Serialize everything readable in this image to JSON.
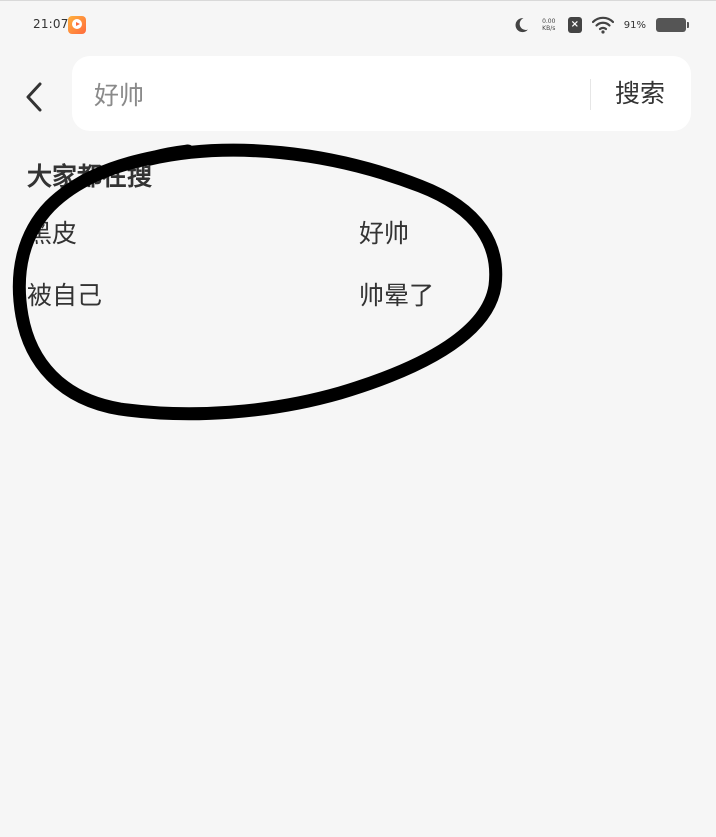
{
  "status_bar": {
    "time": "21:07",
    "net_speed_value": "0.00",
    "net_speed_unit": "KB/s",
    "battery_percent": "91%",
    "icons": [
      "app-notification-icon",
      "moon-icon",
      "x-box-icon",
      "wifi-icon",
      "battery-icon"
    ]
  },
  "search": {
    "query": "好帅",
    "button_label": "搜索"
  },
  "hot_searches": {
    "title": "大家都在搜",
    "items": [
      "黑皮",
      "好帅",
      "被自己",
      "帅晕了"
    ]
  },
  "colors": {
    "background": "#f6f6f6",
    "search_box": "#ffffff",
    "text": "#333333",
    "annotation_stroke": "#000000"
  }
}
